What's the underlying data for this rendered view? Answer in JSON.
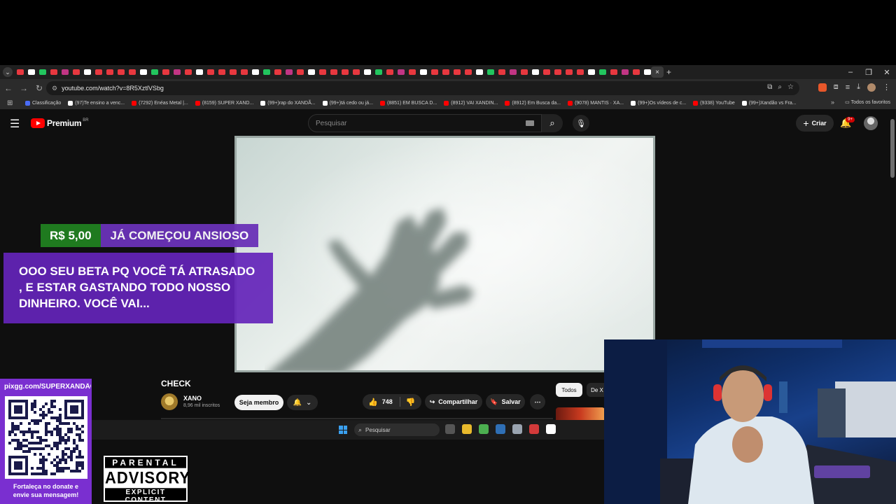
{
  "browser": {
    "tab_count_icons": 66,
    "active_tab_close": "×",
    "new_tab": "+",
    "window_controls": [
      "–",
      "❐",
      "✕"
    ],
    "url": "youtube.com/watch?v=8R5XztlVSbg",
    "bookmarks": [
      {
        "label": "Classificação",
        "color": "#4a6cf7"
      },
      {
        "label": "(97)Te ensino a venc...",
        "color": "#ffffff"
      },
      {
        "label": "(7292) Enéas Metal |...",
        "color": "#ff0000"
      },
      {
        "label": "(8159) SUPER XAND...",
        "color": "#ff0000"
      },
      {
        "label": "(99+)rap do XANDÃ...",
        "color": "#ffffff"
      },
      {
        "label": "(99+)tá cedo ou já...",
        "color": "#ffffff"
      },
      {
        "label": "(8851) EM BUSCA D...",
        "color": "#ff0000"
      },
      {
        "label": "(8912) VAI XANDIN...",
        "color": "#ff0000"
      },
      {
        "label": "(8912) Em Busca da...",
        "color": "#ff0000"
      },
      {
        "label": "(9078) MANTIS · XA...",
        "color": "#ff0000"
      },
      {
        "label": "(99+)Os vídeos de c...",
        "color": "#ffffff"
      },
      {
        "label": "(9338) YouTube",
        "color": "#ff0000"
      },
      {
        "label": "(99+)Xandão vs Fra...",
        "color": "#ffffff"
      }
    ],
    "bookmarks_more": "»",
    "all_favorites": "Todos os favoritos"
  },
  "youtube": {
    "logo_text": "Premium",
    "logo_region": "BR",
    "search_placeholder": "Pesquisar",
    "create_label": "Criar",
    "notif_badge": "9+",
    "video_title": "CHECK",
    "channel_name": "XANO",
    "subscribers": "8,96 mil inscritos",
    "member_label": "Seja membro",
    "likes": "748",
    "share_label": "Compartilhar",
    "save_label": "Salvar",
    "chips": [
      "Todos",
      "De X"
    ]
  },
  "taskbar": {
    "search_label": "Pesquisar",
    "app_colors": [
      "#555555",
      "#e8b92c",
      "#4caf50",
      "#2f6fb5",
      "#9aa4b0",
      "#d33a3a",
      "#ffffff"
    ]
  },
  "overlay": {
    "donation_amount": "R$ 5,00",
    "donor_name": "JÁ COMEÇOU ANSIOSO",
    "donation_message": "OOO SEU BETA PQ VOCÊ TÁ ATRASADO , E ESTAR GASTANDO TODO NOSSO DINHEIRO. VOCÊ VAI...",
    "pix_url": "pixgg.com/SUPERXANDÃO",
    "pix_caption_line1": "Fortaleça no donate e",
    "pix_caption_line2": "envie sua mensagem!",
    "advisory_top": "PARENTAL",
    "advisory_mid": "ADVISORY",
    "advisory_bottom": "EXPLICIT CONTENT"
  }
}
